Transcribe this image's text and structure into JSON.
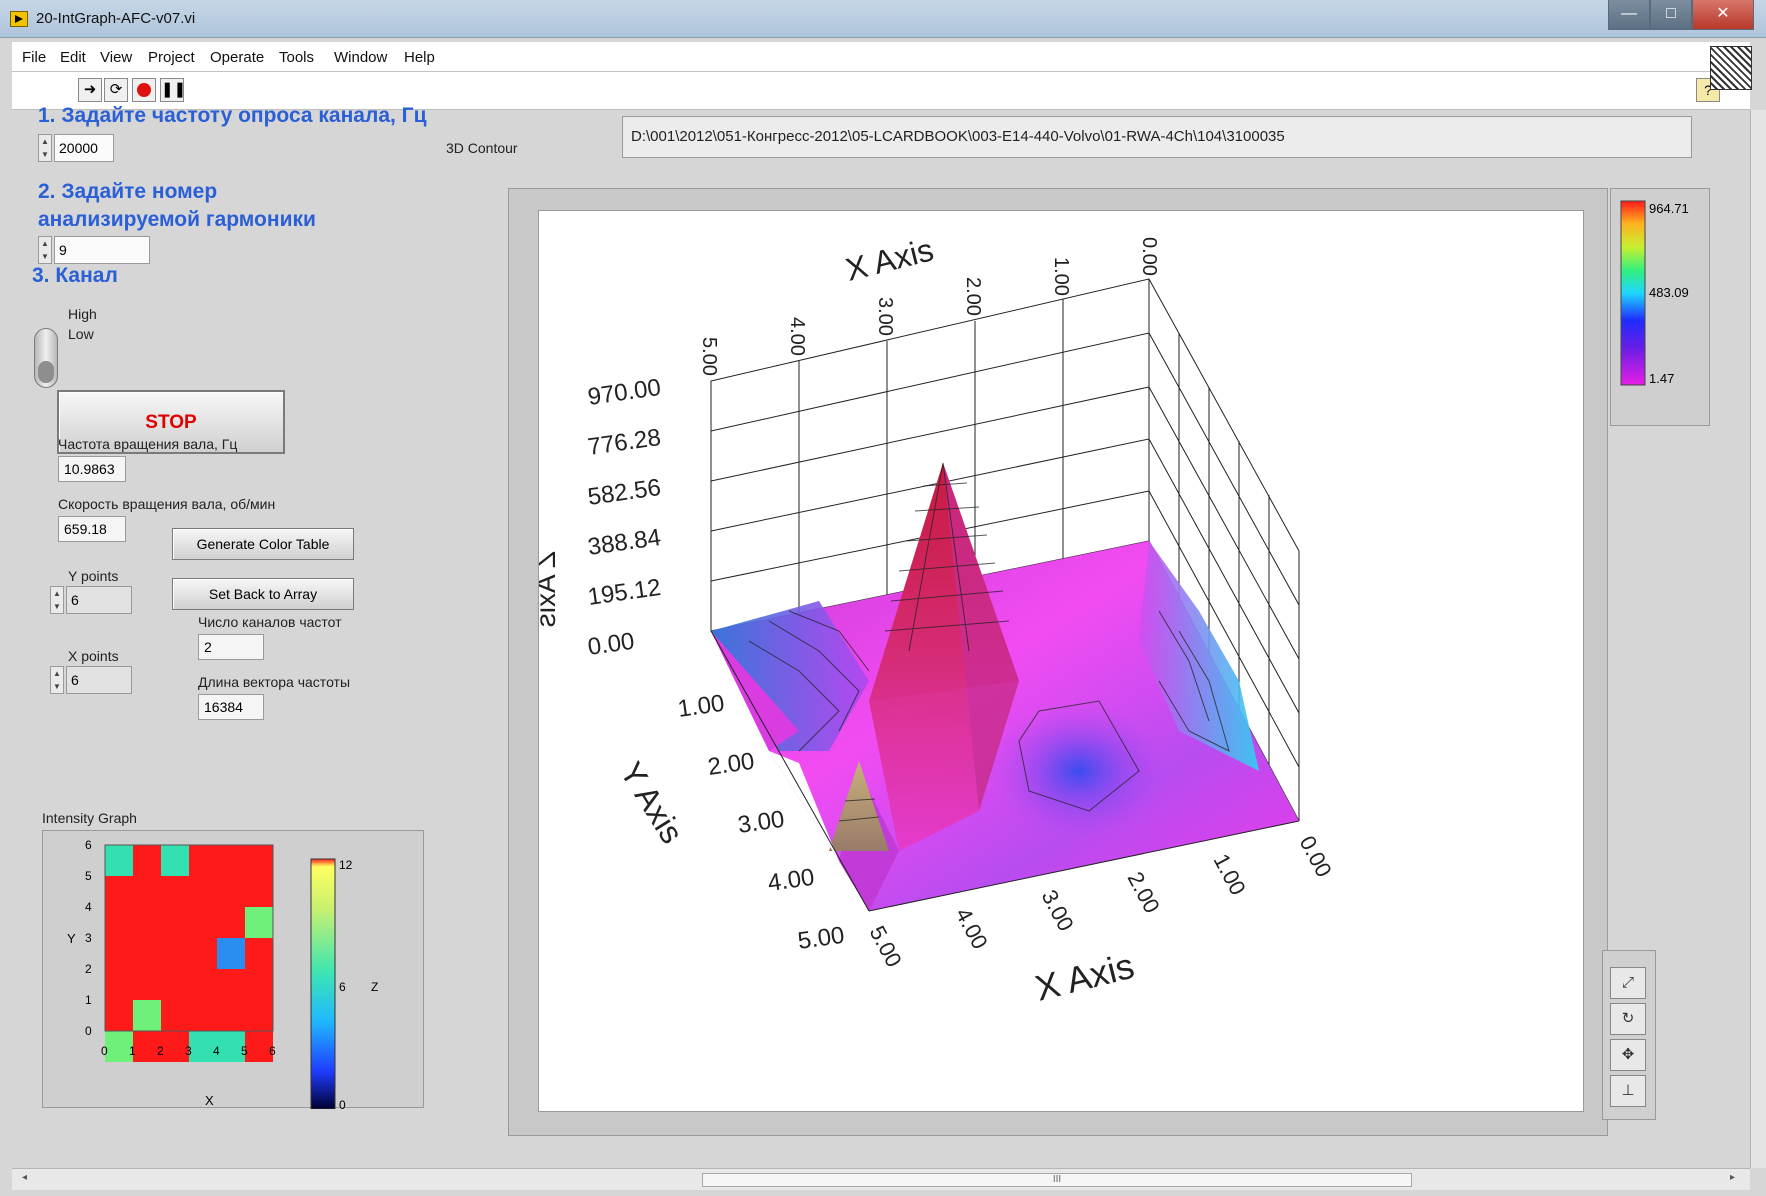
{
  "window": {
    "title": "20-IntGraph-AFC-v07.vi",
    "minimize": "—",
    "maximize": "□",
    "close": "✕"
  },
  "menu": [
    "File",
    "Edit",
    "View",
    "Project",
    "Operate",
    "Tools",
    "Window",
    "Help"
  ],
  "toolbar": {
    "run_icon": "run-arrow-icon",
    "run_cont_icon": "run-continuously-icon",
    "abort_icon": "abort-icon",
    "pause_icon": "pause-icon",
    "help_icon": "help-icon"
  },
  "controls": {
    "rate_label": "1. Задайте частоту опроса канала, Гц",
    "rate_value": "20000",
    "harmonic_label_line1": "2. Задайте номер",
    "harmonic_label_line2": "анализируемой гармоники",
    "harmonic_value": "9",
    "channel_label": "3. Канал",
    "channel_high": "High",
    "channel_low": "Low",
    "stop_label": "STOP",
    "freq_label": "Частота вращения вала, Гц",
    "freq_value": "10.9863",
    "speed_label": "Скорость вращения вала, об/мин",
    "speed_value": "659.18",
    "gen_color_table": "Generate Color Table",
    "set_back": "Set Back to Array",
    "y_points_label": "Y points",
    "y_points_value": "6",
    "x_points_label": "X points",
    "x_points_value": "6",
    "channels_label": "Число каналов частот",
    "channels_value": "2",
    "vector_len_label": "Длина вектора частоты",
    "vector_len_value": "16384",
    "path_value": "D:\\001\\2012\\051-Конгресс-2012\\05-LCARDBOOK\\003-E14-440-Volvo\\01-RWA-4Ch\\104\\3100035"
  },
  "intensity_graph": {
    "label": "Intensity Graph",
    "x_label": "X",
    "y_label": "Y",
    "x_ticks": [
      "0",
      "1",
      "2",
      "3",
      "4",
      "5",
      "6"
    ],
    "y_ticks": [
      "0",
      "1",
      "2",
      "3",
      "4",
      "5",
      "6"
    ],
    "scale_ticks": [
      "0",
      "6",
      "12"
    ],
    "scale_label": "Z",
    "colors": {
      "red": "#ff1a1a",
      "green": "#6ff07a",
      "teal": "#33e0b0",
      "blue": "#2a8ef0"
    },
    "grid": [
      [
        "red",
        "red",
        "red",
        "red",
        "red",
        "red"
      ],
      [
        "red",
        "red",
        "red",
        "red",
        "red",
        "green"
      ],
      [
        "red",
        "red",
        "red",
        "red",
        "blue",
        "red"
      ],
      [
        "red",
        "red",
        "red",
        "red",
        "red",
        "red"
      ],
      [
        "red",
        "green",
        "red",
        "red",
        "red",
        "red"
      ],
      [
        "green",
        "red",
        "red",
        "teal",
        "teal",
        "red"
      ]
    ],
    "grid_top_row": [
      "teal",
      "red",
      "teal",
      "red",
      "red",
      "red"
    ]
  },
  "graph3d": {
    "label": "3D Contour",
    "x_axis_label": "X Axis",
    "y_axis_label": "Y Axis",
    "z_axis_label": "Z Axis",
    "z_ticks": [
      "970.00",
      "776.28",
      "582.56",
      "388.84",
      "195.12",
      "0.00"
    ],
    "y_ticks": [
      "1.00",
      "2.00",
      "3.00",
      "4.00",
      "5.00"
    ],
    "x_ticks_top": [
      "5.00",
      "4.00",
      "3.00",
      "2.00",
      "1.00",
      "0.00"
    ],
    "x_ticks_bottom": [
      "5.00",
      "4.00",
      "3.00",
      "2.00",
      "1.00",
      "0.00"
    ]
  },
  "color_legend": {
    "max": "964.71",
    "mid": "483.09",
    "min": "1.47"
  },
  "tools": [
    "zoom-icon",
    "rotate-icon",
    "pan-icon",
    "reset-view-icon"
  ],
  "scrollbar": {
    "thumb": "III"
  }
}
